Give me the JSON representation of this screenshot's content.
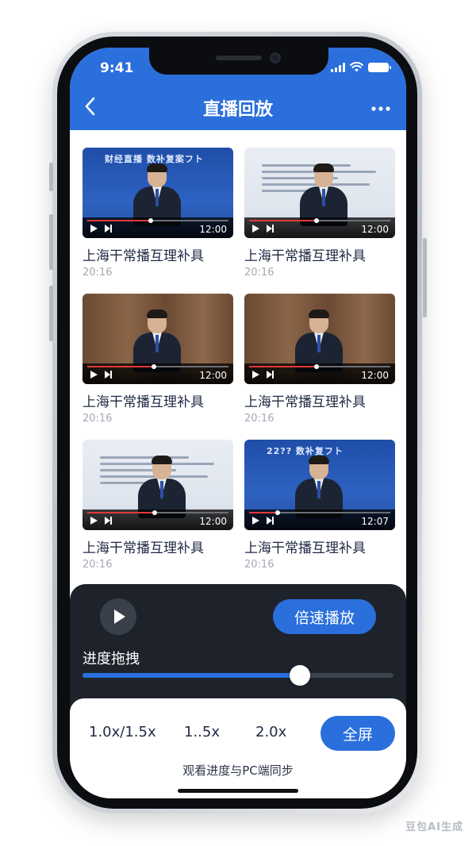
{
  "status_bar": {
    "time": "9:41"
  },
  "header": {
    "back_icon": "chevron-left-icon",
    "title": "直播回放",
    "more_icon": "more-dots-icon"
  },
  "videos": [
    {
      "title": "上海干常播互理补具",
      "date": "20:16",
      "duration": "12:00",
      "thumb_style": "stage",
      "banner": "财经直播 数补复案フト",
      "progress": 0.45
    },
    {
      "title": "上海干常播互理补具",
      "date": "20:16",
      "duration": "12:00",
      "thumb_style": "slide",
      "banner": "",
      "progress": 0.48
    },
    {
      "title": "上海干常播互理补具",
      "date": "20:16",
      "duration": "12:00",
      "thumb_style": "wood",
      "banner": "",
      "progress": 0.47
    },
    {
      "title": "上海干常播互理补具",
      "date": "20:16",
      "duration": "12:00",
      "thumb_style": "wood",
      "banner": "",
      "progress": 0.48
    },
    {
      "title": "上海干常播互理补具",
      "date": "20:16",
      "duration": "12:00",
      "thumb_style": "slide",
      "banner": "",
      "progress": 0.48
    },
    {
      "title": "上海干常播互理补具",
      "date": "20:16",
      "duration": "12:07",
      "thumb_style": "stage",
      "banner": "22?? 数补复フト",
      "progress": 0.2
    }
  ],
  "player": {
    "play_icon": "play-icon",
    "speed_label": "倍速播放",
    "seek_label": "进度拖拽",
    "seek_progress": 0.7
  },
  "sheet": {
    "rates": [
      "1.0x/1.5x",
      "1..5x",
      "2.0x"
    ],
    "fullscreen_label": "全屏",
    "sync_text": "观看进度与PC端同步"
  },
  "watermark": "豆包AI生成",
  "colors": {
    "accent": "#2a6fdc",
    "panel": "#1e232b",
    "progress_red": "#e2393a"
  }
}
